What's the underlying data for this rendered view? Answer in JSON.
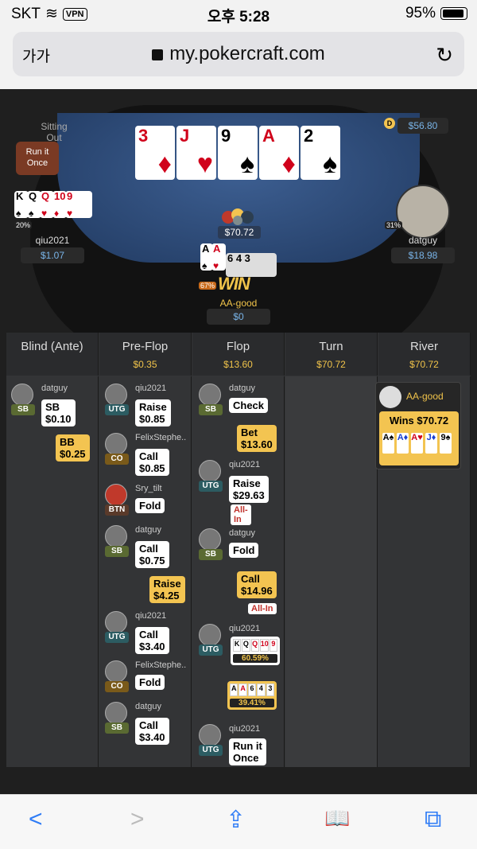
{
  "status": {
    "carrier": "SKT",
    "vpn": "VPN",
    "time": "오후 5:28",
    "battery": "95%"
  },
  "browser": {
    "text_size": "가가",
    "url": "my.pokercraft.com",
    "reload": "↻"
  },
  "table": {
    "sitting_out": "Sitting Out",
    "top_right_stack": "$56.80",
    "dealer": "D",
    "run_it_once": "Run it Once",
    "board": [
      {
        "rank": "3",
        "suit": "♦",
        "color": "red"
      },
      {
        "rank": "J",
        "suit": "♥",
        "color": "red"
      },
      {
        "rank": "9",
        "suit": "♠",
        "color": "black"
      },
      {
        "rank": "A",
        "suit": "♦",
        "color": "red"
      },
      {
        "rank": "2",
        "suit": "♠",
        "color": "black"
      }
    ],
    "pot": "$70.72",
    "left_player": {
      "name": "qiu2021",
      "stack": "$1.07",
      "equity": "20%",
      "cards": [
        "K♠",
        "Q♠",
        "Q♥",
        "10♦",
        "9♥"
      ]
    },
    "right_player": {
      "name": "datguy",
      "stack": "$18.98",
      "equity": "31%"
    },
    "hero": {
      "name": "AA-good",
      "stack": "$0",
      "equity": "67%",
      "result": "WIN",
      "cards": [
        "A♠",
        "A♥",
        "6",
        "4",
        "3"
      ]
    }
  },
  "streets": [
    {
      "label": "Blind (Ante)",
      "amount": ""
    },
    {
      "label": "Pre-Flop",
      "amount": "$0.35"
    },
    {
      "label": "Flop",
      "amount": "$13.60"
    },
    {
      "label": "Turn",
      "amount": "$70.72"
    },
    {
      "label": "River",
      "amount": "$70.72"
    }
  ],
  "blind": {
    "p1": "datguy",
    "p1_pos": "SB",
    "p1_act": "SB",
    "p1_amt": "$0.10",
    "bb_act": "BB",
    "bb_amt": "$0.25"
  },
  "preflop": [
    {
      "name": "qiu2021",
      "pos": "UTG",
      "act": "Raise",
      "amt": "$0.85"
    },
    {
      "name": "FelixStephe..",
      "pos": "CO",
      "act": "Call",
      "amt": "$0.85"
    },
    {
      "name": "Sry_tilt",
      "pos": "BTN",
      "act": "Fold",
      "amt": ""
    },
    {
      "name": "datguy",
      "pos": "SB",
      "act": "Call",
      "amt": "$0.75"
    },
    {
      "hero_act": "Raise",
      "hero_amt": "$4.25"
    },
    {
      "name": "qiu2021",
      "pos": "UTG",
      "act": "Call",
      "amt": "$3.40"
    },
    {
      "name": "FelixStephe..",
      "pos": "CO",
      "act": "Fold",
      "amt": ""
    },
    {
      "name": "datguy",
      "pos": "SB",
      "act": "Call",
      "amt": "$3.40"
    }
  ],
  "flop": {
    "a1": {
      "name": "datguy",
      "pos": "SB",
      "act": "Check"
    },
    "h1": {
      "act": "Bet",
      "amt": "$13.60"
    },
    "a2": {
      "name": "qiu2021",
      "pos": "UTG",
      "act": "Raise",
      "amt": "$29.63",
      "allin": "All-In"
    },
    "a3": {
      "name": "datguy",
      "pos": "SB",
      "act": "Fold"
    },
    "h2": {
      "act": "Call",
      "amt": "$14.96",
      "allin": "All-In"
    },
    "a4": {
      "name": "qiu2021",
      "pos": "UTG",
      "cards": "KQQ109",
      "eq": "60.59%"
    },
    "h3": {
      "cards": "AA643",
      "eq": "39.41%"
    },
    "a5": {
      "name": "qiu2021",
      "pos": "UTG",
      "act": "Run it",
      "act2": "Once"
    }
  },
  "river": {
    "winner": "AA-good",
    "wins": "Wins $70.72",
    "cards": [
      "A♠",
      "A♦",
      "A♥",
      "J♦",
      "9♠"
    ]
  },
  "toolbar": {
    "back": "<",
    "fwd": ">",
    "share": "⇪",
    "book": "📖",
    "tabs": "⧉"
  }
}
